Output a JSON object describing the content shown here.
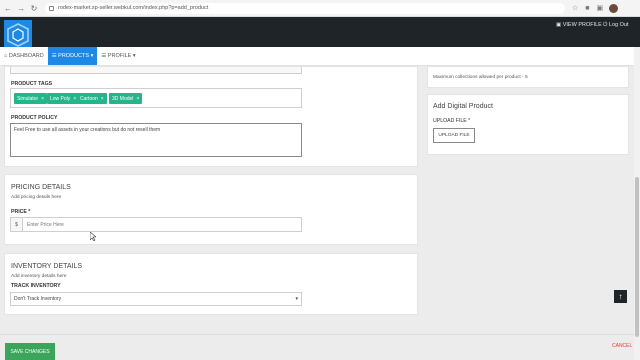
{
  "browser": {
    "url": "rodex-market.sp-seller.webkul.com/index.php?p=add_product"
  },
  "header": {
    "view_profile": "VIEW PROFILE",
    "log_out": "Log Out"
  },
  "nav": {
    "dashboard": "DASHBOARD",
    "products": "PRODUCTS",
    "profile": "PROFILE"
  },
  "product": {
    "tags_label": "PRODUCT TAGS",
    "tags": [
      "Simulator",
      "Low Poly",
      "Cartoon",
      "3D Model"
    ],
    "policy_label": "PRODUCT POLICY",
    "policy_value": "Feel Free to use all assets in your creations but do not resell them"
  },
  "pricing": {
    "title": "PRICING DETAILS",
    "desc": "Add pricing details here",
    "price_label": "PRICE *",
    "currency": "$",
    "price_placeholder": "Enter Price Here"
  },
  "inventory": {
    "title": "INVENTORY DETAILS",
    "desc": "Add inventory details here",
    "track_label": "TRACK INVENTORY",
    "track_value": "Don't Track Inventory"
  },
  "sidebar": {
    "collections_note": "Maximum collections allowed per product - 5",
    "digital_title": "Add Digital Product",
    "upload_label": "UPLOAD FILE *",
    "upload_button": "UPLOAD FILE"
  },
  "footer": {
    "save": "SAVE CHANGES",
    "cancel": "CANCEL"
  },
  "colors": {
    "header_bg": "#1f2428",
    "accent_blue": "#1e88e5",
    "tag_green": "#25b58a",
    "save_green": "#3ba55c",
    "cancel_red": "#e53935"
  }
}
